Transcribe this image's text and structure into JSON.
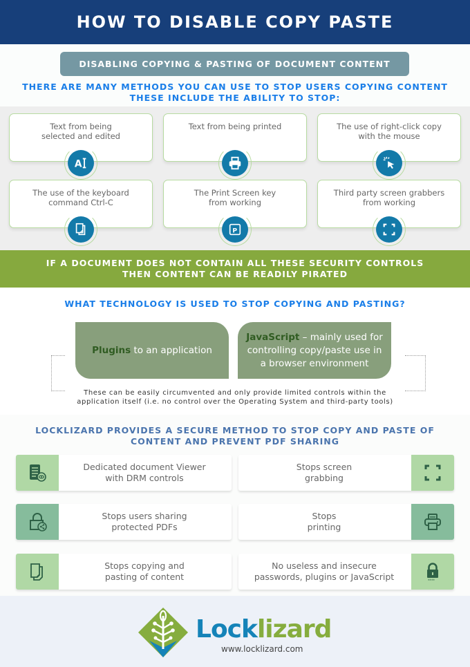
{
  "header": {
    "title": "HOW TO DISABLE COPY PASTE"
  },
  "section1": {
    "pill": "DISABLING COPYING & PASTING OF DOCUMENT CONTENT",
    "intro_line1": "THERE ARE MANY METHODS YOU CAN USE TO STOP USERS COPYING CONTENT",
    "intro_line2": "THESE INCLUDE THE ABILITY TO STOP:",
    "cards": [
      {
        "line1": "Text from being",
        "line2": "selected and edited",
        "icon": "text-select-icon"
      },
      {
        "line1": "Text from being printed",
        "line2": "",
        "icon": "printer-icon"
      },
      {
        "line1": "The use of right-click copy",
        "line2": "with the mouse",
        "icon": "cursor-click-icon"
      },
      {
        "line1": "The use of the keyboard",
        "line2": "command Ctrl-C",
        "icon": "copy-icon"
      },
      {
        "line1": "The Print Screen key",
        "line2": "from working",
        "icon": "print-screen-key-icon"
      },
      {
        "line1": "Third party screen grabbers",
        "line2": "from working",
        "icon": "screen-capture-icon"
      }
    ]
  },
  "banner": {
    "line1": "IF A DOCUMENT DOES NOT CONTAIN ALL THESE SECURITY CONTROLS",
    "line2": "THEN CONTENT CAN BE READILY PIRATED"
  },
  "technology": {
    "question": "WHAT TECHNOLOGY IS USED TO STOP COPYING AND PASTING?",
    "left_bold": "Plugins",
    "left_rest": " to an application",
    "right_bold": "JavaScript",
    "right_rest1": " – mainly used for",
    "right_rest2": "controlling copy/paste use in",
    "right_rest3": "a browser environment",
    "note_line1": "These can be easily circumvented and only provide limited controls within the",
    "note_line2": "application itself (i.e. no control over the Operating System and third-party tools)"
  },
  "locklizard": {
    "heading_line1": "LOCKLIZARD PROVIDES A SECURE METHOD TO STOP COPY AND PASTE OF",
    "heading_line2": "CONTENT AND PREVENT PDF SHARING",
    "features": [
      {
        "line1": "Dedicated document Viewer",
        "line2": "with DRM controls",
        "icon": "document-viewer-icon"
      },
      {
        "line1": "Stops screen",
        "line2": "grabbing",
        "icon": "screen-capture-icon"
      },
      {
        "line1": "Stops users sharing",
        "line2": "protected PDFs",
        "icon": "lock-share-icon"
      },
      {
        "line1": "Stops",
        "line2": "printing",
        "icon": "printer-icon"
      },
      {
        "line1": "Stops copying and",
        "line2": "pasting of content",
        "icon": "copy-pages-icon"
      },
      {
        "line1": "No useless and insecure",
        "line2": "passwords, plugins or JavaScript",
        "icon": "password-lock-icon"
      }
    ]
  },
  "footer": {
    "brand_part1": "Lock",
    "brand_part2": "lizard",
    "url": "www.locklizard.com"
  },
  "colors": {
    "header_bg": "#173f7a",
    "pill_bg": "#7598a3",
    "accent_blue": "#1a7ee8",
    "badge_blue": "#137aa9",
    "banner_green": "#86a93e",
    "tech_box": "#889f7c",
    "feature_light_green": "#b0d8a5",
    "feature_mid_green": "#86bc9c"
  }
}
